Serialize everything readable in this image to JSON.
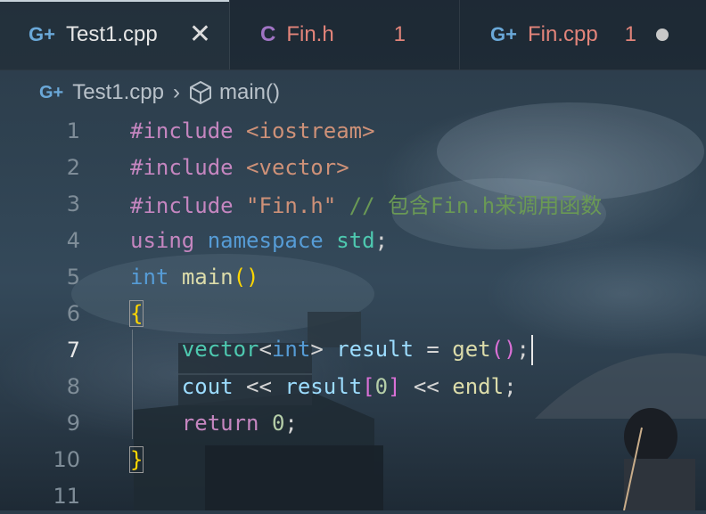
{
  "tabs": [
    {
      "label": "Test1.cpp",
      "icon": "cpp-icon",
      "active": true
    },
    {
      "label": "Fin.h",
      "icon": "c-header-icon",
      "problems": "1"
    },
    {
      "label": "Fin.cpp",
      "icon": "cpp-icon",
      "problems": "1",
      "unsaved": true
    }
  ],
  "breadcrumb": {
    "file": "Test1.cpp",
    "symbol": "main()"
  },
  "line_numbers": [
    "1",
    "2",
    "3",
    "4",
    "5",
    "6",
    "7",
    "8",
    "9",
    "10",
    "11"
  ],
  "current_line": "7",
  "code": {
    "l1": {
      "directive": "#include",
      "header": "<iostream>"
    },
    "l2": {
      "directive": "#include",
      "header": "<vector>"
    },
    "l3": {
      "directive": "#include",
      "header": "\"Fin.h\"",
      "comment": "// 包含Fin.h来调用函数"
    },
    "l4": {
      "kw1": "using",
      "kw2": "namespace",
      "ns": "std",
      "end": ";"
    },
    "l5": {
      "type": "int",
      "name": "main",
      "paren": "()"
    },
    "l6": {
      "brace": "{"
    },
    "l7": {
      "type": "vector",
      "lt": "<",
      "targ": "int",
      "gt": ">",
      "var": "result",
      "eq": "=",
      "call": "get",
      "paren": "()",
      "end": ";"
    },
    "l8": {
      "obj": "cout",
      "op": "<<",
      "var": "result",
      "lb": "[",
      "idx": "0",
      "rb": "]",
      "op2": "<<",
      "endl": "endl",
      "end": ";"
    },
    "l9": {
      "kw": "return",
      "val": "0",
      "end": ";"
    },
    "l10": {
      "brace": "}"
    }
  },
  "colors": {
    "keyword": "#c586c0",
    "storage": "#569cd6",
    "string": "#ce9178",
    "comment": "#6a9955",
    "type": "#4ec9b0",
    "function": "#dcdcaa",
    "variable": "#9cdcfe",
    "number": "#b5cea8",
    "bracket1": "#ffd700",
    "bracket2": "#da70d6",
    "modified": "#e2847a"
  }
}
